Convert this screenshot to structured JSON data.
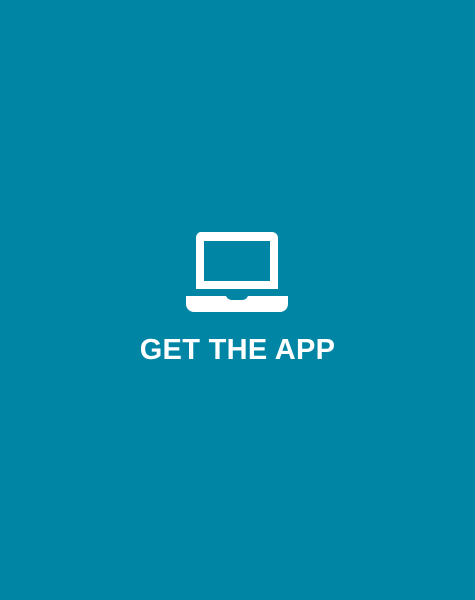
{
  "tile": {
    "background_color": "#0086a4",
    "foreground_color": "#ffffff",
    "icon": "laptop-icon",
    "label": "GET THE APP"
  }
}
